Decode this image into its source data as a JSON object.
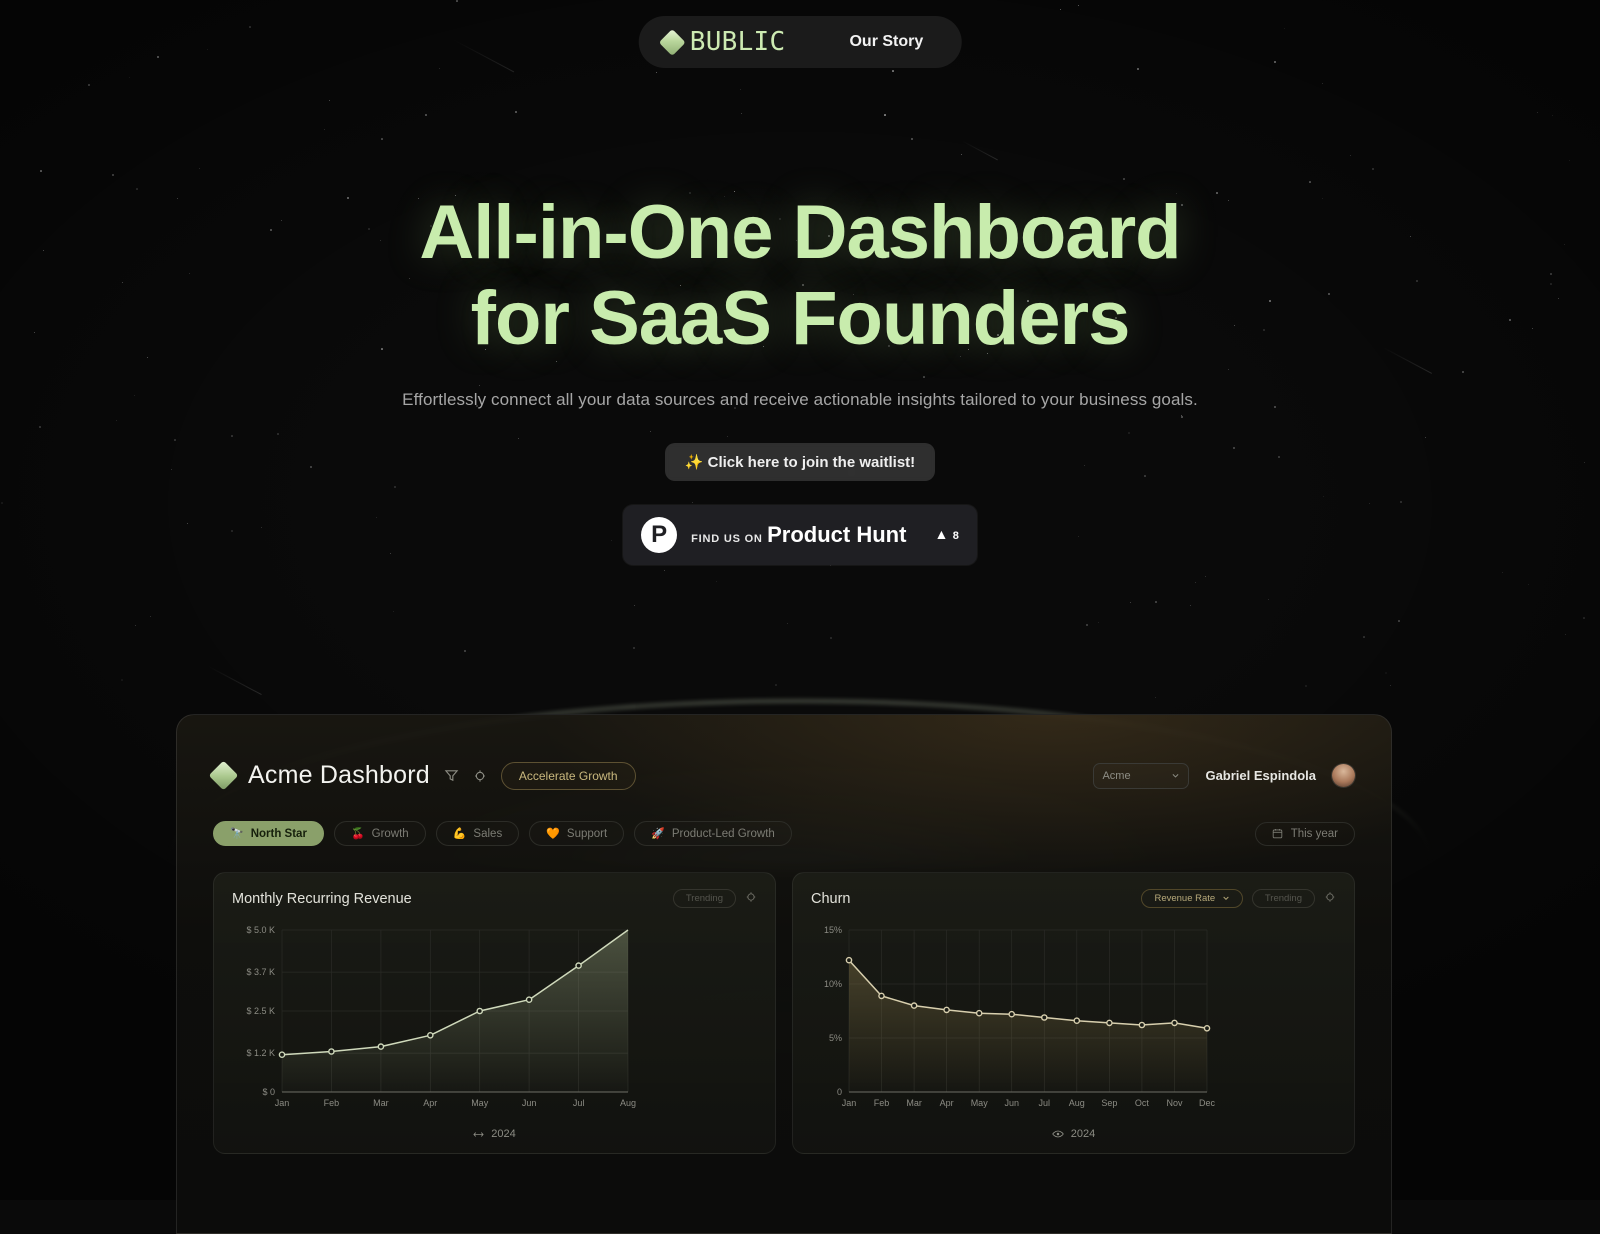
{
  "nav": {
    "brand": "BUBLIC",
    "logo_icon": "diamond-icon",
    "link": "Our Story"
  },
  "hero": {
    "heading_line1": "All-in-One Dashboard",
    "heading_line2": "for SaaS Founders",
    "subtitle": "Effortlessly connect all your data sources and receive actionable insights tailored to your business goals.",
    "waitlist_label": "✨ Click here to join the waitlist!",
    "heading_color": "#c8ecad",
    "product_hunt": {
      "small_label": "FIND US ON",
      "big_label": "Product Hunt",
      "upvote_arrow": "▲",
      "upvote_count": "8",
      "logo_letter": "P"
    }
  },
  "dashboard": {
    "logo_icon": "diamond-icon",
    "title": "Acme Dashbord",
    "filter_icon": "filter-icon",
    "plug_icon": "plug-icon",
    "accelerate_pill": "Accelerate Growth",
    "org_select": "Acme",
    "org_select_icon": "chevron-down-icon",
    "user_name": "Gabriel Espindola",
    "avatar_icon": "avatar",
    "tabs": [
      {
        "label": "North Star",
        "emoji": "🔭",
        "active": true
      },
      {
        "label": "Growth",
        "emoji": "🍒",
        "active": false
      },
      {
        "label": "Sales",
        "emoji": "💪",
        "active": false
      },
      {
        "label": "Support",
        "emoji": "🧡",
        "active": false
      },
      {
        "label": "Product-Led Growth",
        "emoji": "🚀",
        "active": false
      }
    ],
    "date_range": "This year",
    "date_icon": "calendar-icon",
    "cards": [
      {
        "title": "Monthly Recurring Revenue",
        "badge": "Trending",
        "plug_icon": "plug-icon",
        "footer_year": "2024",
        "footer_icon": "compare-icon"
      },
      {
        "title": "Churn",
        "dropdown": "Revenue Rate",
        "dropdown_icon": "chevron-down-icon",
        "badge": "Trending",
        "plug_icon": "plug-icon",
        "footer_year": "2024",
        "footer_icon": "eye-icon"
      }
    ]
  },
  "chart_data": [
    {
      "type": "area",
      "title": "Monthly Recurring Revenue",
      "xlabel": "",
      "ylabel": "",
      "categories": [
        "Jan",
        "Feb",
        "Mar",
        "Apr",
        "May",
        "Jun",
        "Jul",
        "Aug"
      ],
      "values": [
        1150,
        1250,
        1400,
        1750,
        2500,
        2850,
        3900,
        5000
      ],
      "ytick_labels": [
        "$ 5.0 K",
        "$ 3.7 K",
        "$ 2.5 K",
        "$ 1.2 K",
        "$ 0"
      ],
      "ytick_values": [
        5000,
        3700,
        2500,
        1200,
        0
      ],
      "ylim": [
        0,
        5000
      ],
      "grid": true,
      "legend": "none",
      "series_color": "#cfd9bb",
      "fill_color": "#b8c79a"
    },
    {
      "type": "line",
      "title": "Churn",
      "xlabel": "",
      "ylabel": "",
      "categories": [
        "Jan",
        "Feb",
        "Mar",
        "Apr",
        "May",
        "Jun",
        "Jul",
        "Aug",
        "Sep",
        "Oct",
        "Nov",
        "Dec"
      ],
      "values": [
        12.2,
        8.9,
        8.0,
        7.6,
        7.3,
        7.2,
        6.9,
        6.6,
        6.4,
        6.2,
        6.4,
        5.9
      ],
      "ytick_labels": [
        "15%",
        "10%",
        "5%",
        "0"
      ],
      "ytick_values": [
        15,
        10,
        5,
        0
      ],
      "ylim": [
        0,
        15
      ],
      "grid": true,
      "legend": "none",
      "series_color": "#d8cfae",
      "fill_color": "#8a7a4a"
    }
  ]
}
